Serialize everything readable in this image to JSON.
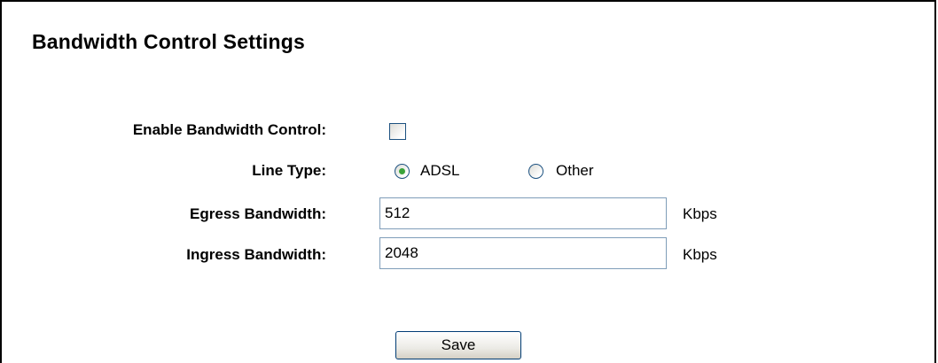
{
  "page": {
    "title": "Bandwidth Control Settings"
  },
  "form": {
    "enable_label": "Enable Bandwidth Control:",
    "enable_checked": false,
    "line_type_label": "Line Type:",
    "line_type_options": [
      "ADSL",
      "Other"
    ],
    "line_type_selected": "ADSL",
    "egress_label": "Egress Bandwidth:",
    "egress_value": "512",
    "egress_unit": "Kbps",
    "ingress_label": "Ingress Bandwidth:",
    "ingress_value": "2048",
    "ingress_unit": "Kbps",
    "save_label": "Save"
  },
  "colors": {
    "radio_selected_dot": "#3aa33a",
    "control_border": "#1c5180",
    "input_border": "#7f9db9"
  }
}
